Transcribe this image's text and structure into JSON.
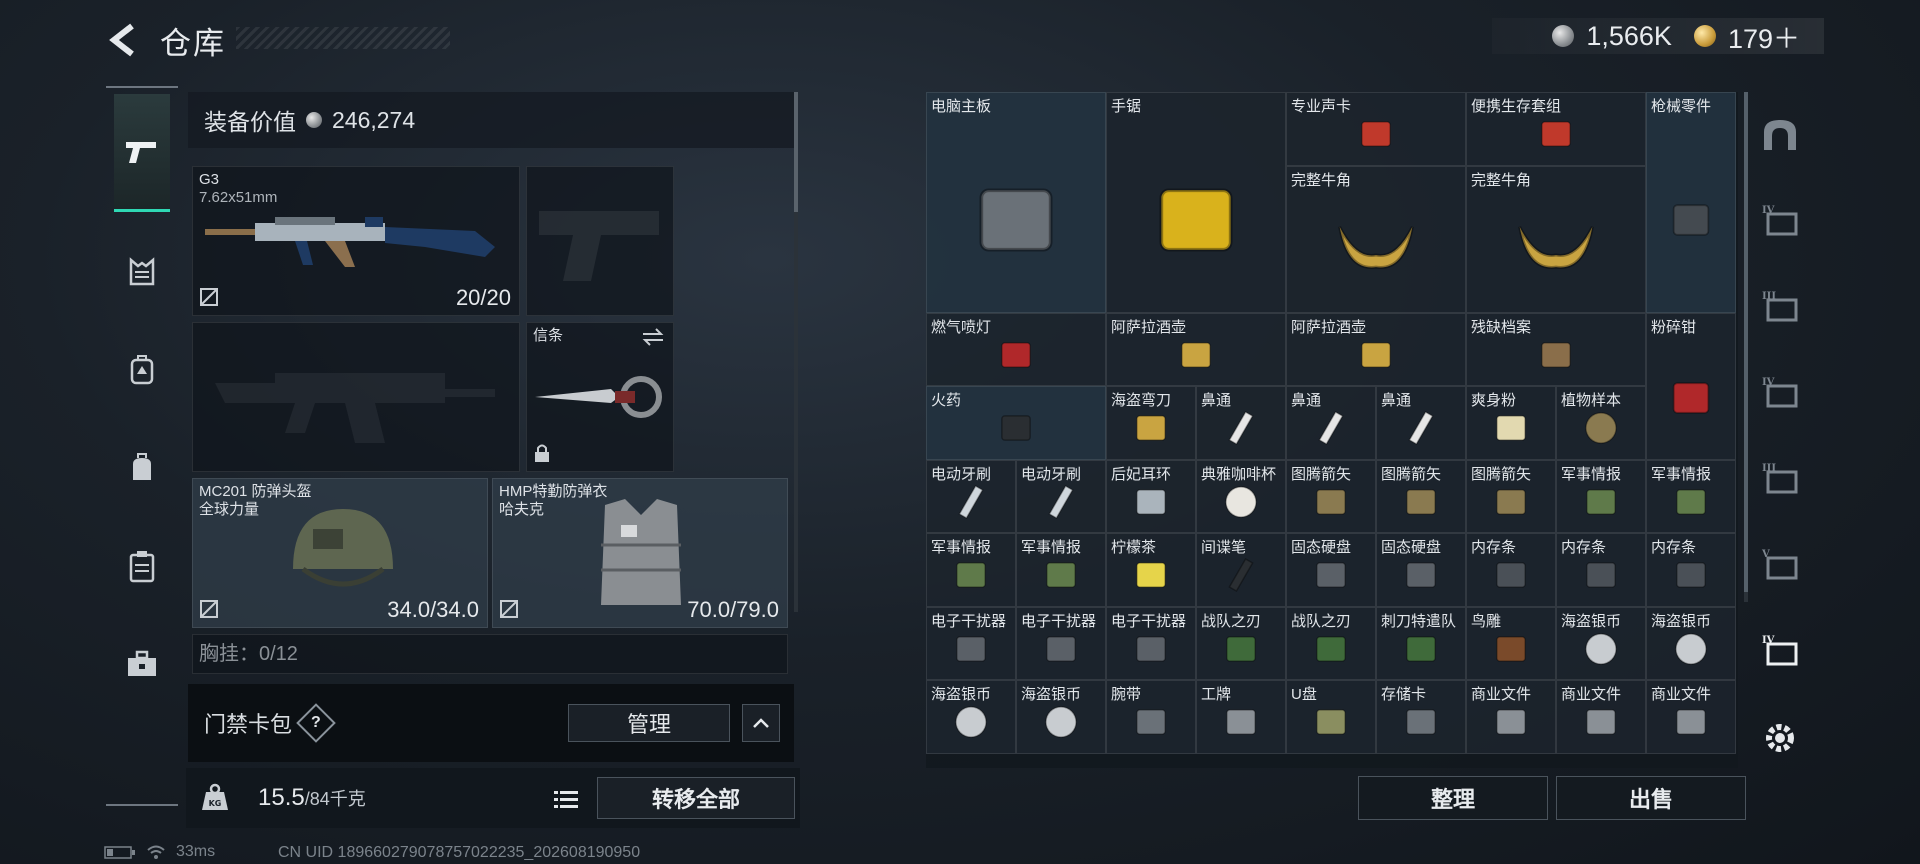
{
  "header": {
    "title": "仓库",
    "currency": [
      {
        "icon": "silver-coin-icon",
        "value": "1,566K"
      },
      {
        "icon": "gold-coin-icon",
        "value": "179＋"
      }
    ]
  },
  "left_nav": [
    {
      "name": "weapon",
      "icon": "pistol-icon",
      "active": true
    },
    {
      "name": "armor",
      "icon": "chest-rig-icon"
    },
    {
      "name": "backpack",
      "icon": "backpack-alt-icon"
    },
    {
      "name": "bag",
      "icon": "bag-icon"
    },
    {
      "name": "container",
      "icon": "case-icon"
    },
    {
      "name": "kit",
      "icon": "toolbox-icon"
    }
  ],
  "equipment": {
    "header_label": "装备价值",
    "header_value": "246,274",
    "primary": {
      "name": "G3",
      "caliber": "7.62x51mm",
      "value": "20/20"
    },
    "knife": {
      "name": "信条"
    },
    "helmet": {
      "name": "MC201 防弹头盔",
      "sub": "全球力量",
      "value": "34.0/34.0"
    },
    "vest": {
      "name": "HMP特勤防弹衣",
      "sub": "哈夫克",
      "value": "70.0/79.0"
    },
    "next_label": "胸挂：0/12"
  },
  "keybag": {
    "label": "门禁卡包",
    "help": "?",
    "manage": "管理"
  },
  "footer_left": {
    "weight": "15.5",
    "weight_unit": "/84千克",
    "transfer": "转移全部"
  },
  "status": {
    "ping": "33ms",
    "uid": "CN UID 1896602790787570222​35_202608190950"
  },
  "stash_items": [
    {
      "label": "电脑主板",
      "icon": "motherboard-icon"
    },
    {
      "label": "手锯",
      "icon": "circular-saw-icon"
    },
    {
      "label": "专业声卡",
      "icon": "sound-card-icon"
    },
    {
      "label": "便携生存套组",
      "icon": "survival-kit-icon"
    },
    {
      "label": "枪械零件",
      "icon": "gun-parts-icon"
    },
    {
      "label": "完整牛角",
      "icon": "horns-icon"
    },
    {
      "label": "完整牛角",
      "icon": "horns-icon"
    },
    {
      "label": "燃气喷灯",
      "icon": "blowtorch-icon"
    },
    {
      "label": "阿萨拉酒壶",
      "icon": "ewer-icon"
    },
    {
      "label": "阿萨拉酒壶",
      "icon": "ewer-icon"
    },
    {
      "label": "残缺档案",
      "icon": "archive-icon"
    },
    {
      "label": "粉碎钳",
      "icon": "crusher-plier-icon"
    },
    {
      "label": "火药",
      "icon": "gunpowder-icon"
    },
    {
      "label": "海盗弯刀",
      "icon": "scimitar-icon"
    },
    {
      "label": "鼻通",
      "icon": "inhaler-icon"
    },
    {
      "label": "鼻通",
      "icon": "inhaler-icon"
    },
    {
      "label": "鼻通",
      "icon": "inhaler-icon"
    },
    {
      "label": "爽身粉",
      "icon": "powder-can-icon"
    },
    {
      "label": "植物样本",
      "icon": "petri-dish-icon"
    },
    {
      "label": "电动牙刷",
      "icon": "toothbrush-icon"
    },
    {
      "label": "电动牙刷",
      "icon": "toothbrush-icon"
    },
    {
      "label": "后妃耳环",
      "icon": "earring-icon"
    },
    {
      "label": "典雅咖啡杯",
      "icon": "teacup-icon"
    },
    {
      "label": "图腾箭矢",
      "icon": "arrow-head-icon"
    },
    {
      "label": "图腾箭矢",
      "icon": "arrow-head-icon"
    },
    {
      "label": "图腾箭矢",
      "icon": "arrow-head-icon"
    },
    {
      "label": "军事情报",
      "icon": "intel-icon"
    },
    {
      "label": "军事情报",
      "icon": "intel-icon"
    },
    {
      "label": "军事情报",
      "icon": "intel-icon"
    },
    {
      "label": "军事情报",
      "icon": "intel-icon"
    },
    {
      "label": "柠檬茶",
      "icon": "can-icon"
    },
    {
      "label": "间谍笔",
      "icon": "spy-pen-icon"
    },
    {
      "label": "固态硬盘",
      "icon": "ssd-icon"
    },
    {
      "label": "固态硬盘",
      "icon": "ssd-icon"
    },
    {
      "label": "内存条",
      "icon": "ram-icon"
    },
    {
      "label": "内存条",
      "icon": "ram-icon"
    },
    {
      "label": "内存条",
      "icon": "ram-icon"
    },
    {
      "label": "电子干扰器",
      "icon": "jammer-icon"
    },
    {
      "label": "电子干扰器",
      "icon": "jammer-icon"
    },
    {
      "label": "电子干扰器",
      "icon": "jammer-icon"
    },
    {
      "label": "战队之刃",
      "icon": "game-box-icon"
    },
    {
      "label": "战队之刃",
      "icon": "game-box-icon"
    },
    {
      "label": "刺刀特遣队",
      "icon": "game-box-icon"
    },
    {
      "label": "鸟雕",
      "icon": "bird-statue-icon"
    },
    {
      "label": "海盗银币",
      "icon": "silver-coin-item-icon"
    },
    {
      "label": "海盗银币",
      "icon": "silver-coin-item-icon"
    },
    {
      "label": "海盗银币",
      "icon": "silver-coin-item-icon"
    },
    {
      "label": "海盗银币",
      "icon": "silver-coin-item-icon"
    },
    {
      "label": "腕带",
      "icon": "wristband-icon"
    },
    {
      "label": "工牌",
      "icon": "badge-icon"
    },
    {
      "label": "U盘",
      "icon": "usb-icon"
    },
    {
      "label": "存储卡",
      "icon": "memory-card-icon"
    },
    {
      "label": "商业文件",
      "icon": "document-icon"
    },
    {
      "label": "商业文件",
      "icon": "document-icon"
    },
    {
      "label": "商业文件",
      "icon": "document-icon"
    }
  ],
  "stash_buttons": {
    "sort": "整理",
    "sell": "出售"
  },
  "right_nav": [
    {
      "icon": "vault-icon"
    },
    {
      "icon": "tier-iv-folder-icon"
    },
    {
      "icon": "tier-iii-gun-icon"
    },
    {
      "icon": "tier-iv-plus-icon"
    },
    {
      "icon": "tier-iii-box-icon"
    },
    {
      "icon": "tier-v-money-icon"
    },
    {
      "icon": "tier-iv-hand-icon"
    },
    {
      "icon": "settings-gear-icon"
    }
  ],
  "colors": {
    "accent": "#2fd8b4",
    "panel": "#12181e",
    "cell_blue": "#283a4a"
  }
}
